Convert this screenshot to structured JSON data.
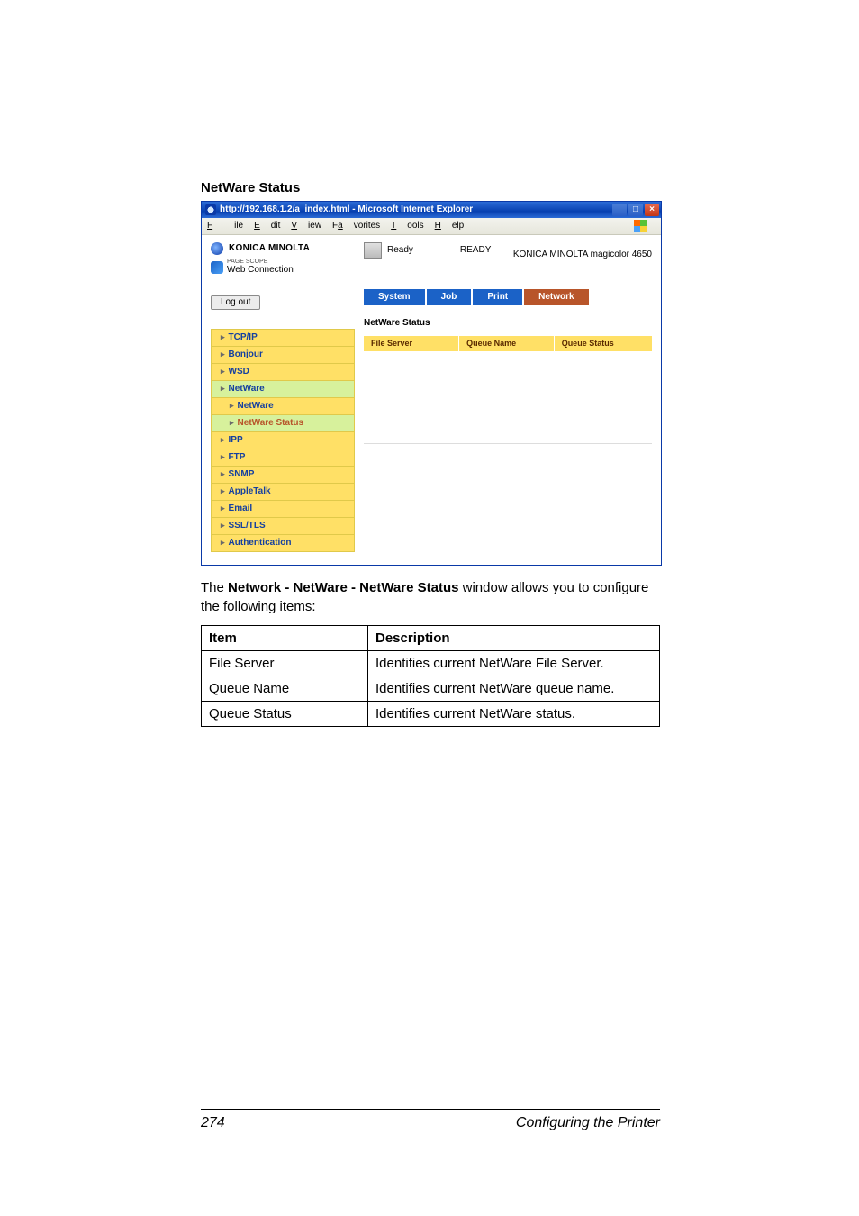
{
  "section_title": "NetWare Status",
  "window": {
    "title": "http://192.168.1.2/a_index.html - Microsoft Internet Explorer",
    "menu": {
      "file": "File",
      "edit": "Edit",
      "view": "View",
      "favorites": "Favorites",
      "tools": "Tools",
      "help": "Help"
    },
    "wincontrols": {
      "min": "_",
      "max": "□",
      "close": "×"
    }
  },
  "brand": {
    "name": "KONICA MINOLTA",
    "sub_small": "PAGE SCOPE",
    "sub": "Web Connection"
  },
  "status": {
    "ready": "Ready",
    "ready_upper": "READY"
  },
  "model": "KONICA MINOLTA magicolor 4650",
  "logout": "Log out",
  "tabs": {
    "system": "System",
    "job": "Job",
    "print": "Print",
    "network": "Network"
  },
  "nav": [
    {
      "label": "TCP/IP",
      "class": "nav-item nav-yellow"
    },
    {
      "label": "Bonjour",
      "class": "nav-item nav-yellow"
    },
    {
      "label": "WSD",
      "class": "nav-item nav-yellow"
    },
    {
      "label": "NetWare",
      "class": "nav-item nav-green"
    },
    {
      "label": "NetWare",
      "class": "nav-sub nav-yellow"
    },
    {
      "label": "NetWare Status",
      "class": "nav-sub nav-green nav-current"
    },
    {
      "label": "IPP",
      "class": "nav-item nav-yellow"
    },
    {
      "label": "FTP",
      "class": "nav-item nav-yellow"
    },
    {
      "label": "SNMP",
      "class": "nav-item nav-yellow"
    },
    {
      "label": "AppleTalk",
      "class": "nav-item nav-yellow"
    },
    {
      "label": "Email",
      "class": "nav-item nav-yellow"
    },
    {
      "label": "SSL/TLS",
      "class": "nav-item nav-yellow"
    },
    {
      "label": "Authentication",
      "class": "nav-item nav-yellow"
    }
  ],
  "content": {
    "heading": "NetWare Status",
    "cols": {
      "file_server": "File Server",
      "queue_name": "Queue Name",
      "queue_status": "Queue Status"
    }
  },
  "caption": {
    "pre": "The ",
    "bold": "Network - NetWare - NetWare Status",
    "post": " window allows you to configure the following items:"
  },
  "desc_table": {
    "headers": {
      "item": "Item",
      "description": "Description"
    },
    "rows": [
      {
        "item": "File Server",
        "desc": "Identifies current NetWare File Server."
      },
      {
        "item": "Queue Name",
        "desc": "Identifies current NetWare queue name."
      },
      {
        "item": "Queue Status",
        "desc": "Identifies current NetWare status."
      }
    ]
  },
  "footer": {
    "page": "274",
    "title": "Configuring the Printer"
  }
}
